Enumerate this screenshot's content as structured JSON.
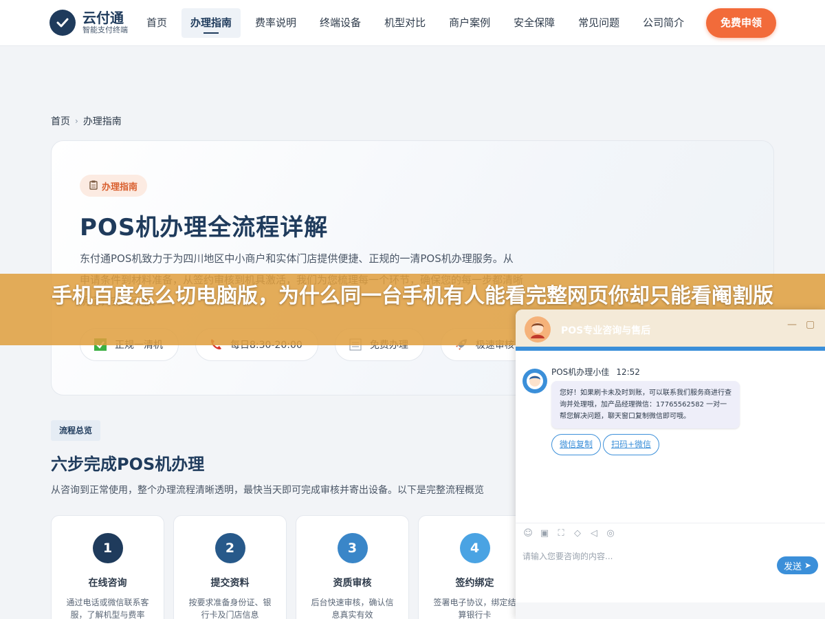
{
  "header": {
    "logo_name": "云付通",
    "logo_sub": "智能支付终端",
    "nav": [
      "首页",
      "办理指南",
      "费率说明",
      "终端设备",
      "机型对比",
      "商户案例",
      "安全保障",
      "常见问题",
      "公司简介"
    ],
    "active_nav": "办理指南",
    "cta": "免费申领"
  },
  "breadcrumb": {
    "home": "首页",
    "sep": "›",
    "current": "办理指南"
  },
  "hero": {
    "tag": "办理指南",
    "title": "POS机办理全流程详解",
    "desc": "东付通POS机致力于为四川地区中小商户和实体门店提供便捷、正规的一清POS机办理服务。从申请条件到材料准备，从签约审核到机具激活，我们为您梳理每一个环节，确保您的每一步都清晰明了，安全可靠。",
    "features": [
      {
        "icon": "check-icon",
        "label": "正规一清机"
      },
      {
        "icon": "phone-icon",
        "label": "每日8:30-20:00"
      },
      {
        "icon": "doc-icon",
        "label": "免费办理"
      },
      {
        "icon": "rocket-icon",
        "label": "极速审核"
      }
    ]
  },
  "section": {
    "tag": "流程总览",
    "title": "六步完成POS机办理",
    "desc": "从咨询到正常使用，整个办理流程清晰透明，最快当天即可完成审核并寄出设备。以下是完整流程概览"
  },
  "steps": [
    {
      "num": "1",
      "title": "在线咨询",
      "desc": "通过电话或微信联系客服，了解机型与费率",
      "color": "#1f3b5c"
    },
    {
      "num": "2",
      "title": "提交资料",
      "desc": "按要求准备身份证、银行卡及门店信息",
      "color": "#27598a"
    },
    {
      "num": "3",
      "title": "资质审核",
      "desc": "后台快速审核，确认信息真实有效",
      "color": "#3a86c8"
    },
    {
      "num": "4",
      "title": "签约绑定",
      "desc": "签署电子协议，绑定结算银行卡",
      "color": "#4aa3e3"
    }
  ],
  "banner": {
    "text": "手机百度怎么切电脑版，为什么同一台手机有人能看完整网页你却只能看阉割版"
  },
  "chat": {
    "title": "POS专业咨询与售后",
    "agent": "POS机办理小佳",
    "time": "12:52",
    "message": "您好！如果刷卡未及时到账，可以联系我们服务商进行查询并处理哦，加产品经理微信：17765562582 一对一帮您解决问题，聊天窗口复制微信即可哦。",
    "quick_replies": [
      "微信复制",
      "扫码+微信"
    ],
    "input_placeholder": "请输入您要咨询的内容...",
    "send": "发送"
  }
}
